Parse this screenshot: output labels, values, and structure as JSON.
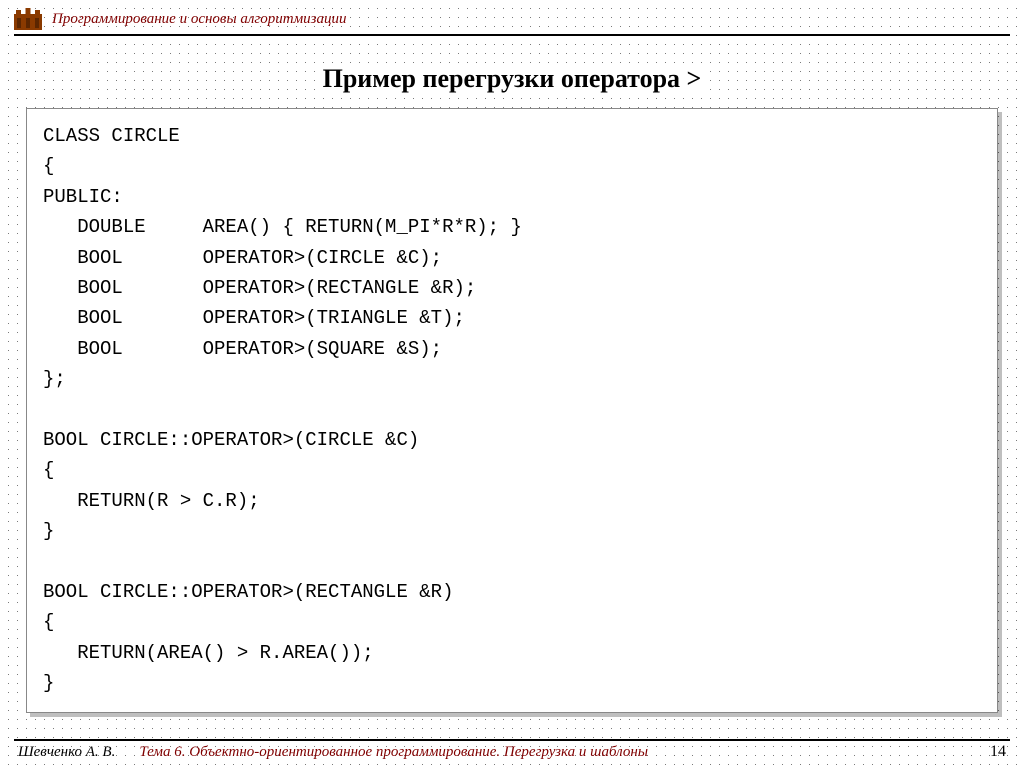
{
  "header": {
    "course_title": "Программирование и основы алгоритмизации"
  },
  "slide": {
    "title": "Пример перегрузки оператора >",
    "code": "class Circle\n{\npublic:\n   double     Area() { return(M_PI*r*r); }\n   bool       operator>(Circle &C);\n   bool       operator>(Rectangle &R);\n   bool       operator>(Triangle &T);\n   bool       operator>(Square &S);\n};\n\nbool Circle::operator>(Circle &C)\n{\n   return(r > C.r);\n}\n\nbool Circle::operator>(Rectangle &R)\n{\n   return(Area() > R.Area());\n}"
  },
  "footer": {
    "author": "Шевченко А. В.",
    "topic": "Тема 6. Объектно-ориентированное программирование. Перегрузка и шаблоны",
    "page": "14"
  }
}
